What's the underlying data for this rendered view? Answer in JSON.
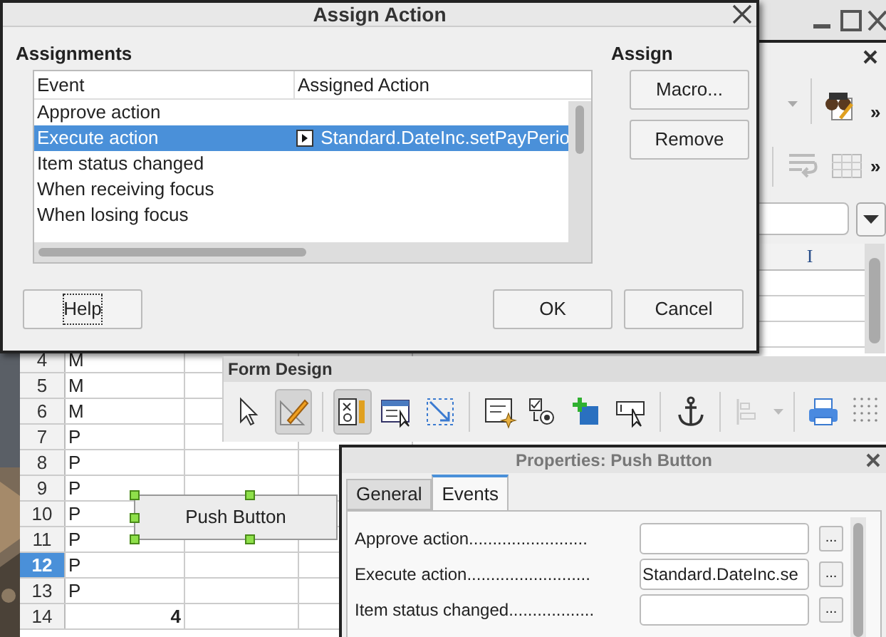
{
  "dialog": {
    "title": "Assign Action",
    "assignments_label": "Assignments",
    "assign_label": "Assign",
    "columns": [
      "Event",
      "Assigned Action"
    ],
    "events": [
      {
        "event": "Approve action",
        "selected": false
      },
      {
        "event": "Execute action",
        "action": "Standard.DateInc.setPayPerio",
        "selected": true
      },
      {
        "event": "Item status changed",
        "selected": false
      },
      {
        "event": "When receiving focus",
        "selected": false
      },
      {
        "event": "When losing focus",
        "selected": false
      }
    ],
    "assign_buttons": [
      "Macro...",
      "Remove"
    ],
    "help_button": "Help",
    "ok_button": "OK",
    "cancel_button": "Cancel"
  },
  "app_window": {
    "overflow_marks": [
      "»",
      "»"
    ],
    "column_header": "I"
  },
  "spreadsheet": {
    "rows": [
      {
        "number": "4",
        "value": "M",
        "kind": "text",
        "selected": false
      },
      {
        "number": "5",
        "value": "M",
        "kind": "text",
        "selected": false
      },
      {
        "number": "6",
        "value": "M",
        "kind": "text",
        "selected": false
      },
      {
        "number": "7",
        "value": "P",
        "kind": "text",
        "selected": false
      },
      {
        "number": "8",
        "value": "P",
        "kind": "text",
        "selected": false
      },
      {
        "number": "9",
        "value": "P",
        "kind": "text",
        "selected": false
      },
      {
        "number": "10",
        "value": "P",
        "kind": "text",
        "selected": false
      },
      {
        "number": "11",
        "value": "P",
        "kind": "text",
        "selected": false
      },
      {
        "number": "12",
        "value": "P",
        "kind": "text",
        "selected": true
      },
      {
        "number": "13",
        "value": "P",
        "kind": "text",
        "selected": false
      },
      {
        "number": "14",
        "value": "4",
        "kind": "number",
        "selected": false
      }
    ]
  },
  "form_design": {
    "title": "Form Design",
    "tools": [
      {
        "kind": "pointer",
        "pressed": false
      },
      {
        "kind": "design",
        "pressed": true
      },
      {
        "kind": "sep"
      },
      {
        "kind": "control",
        "pressed": true
      },
      {
        "kind": "form",
        "pressed": false
      },
      {
        "kind": "frame",
        "pressed": false
      },
      {
        "kind": "sep"
      },
      {
        "kind": "field",
        "pressed": false
      },
      {
        "kind": "order",
        "pressed": false
      },
      {
        "kind": "plus",
        "pressed": false
      },
      {
        "kind": "focus",
        "pressed": false
      },
      {
        "kind": "sep"
      },
      {
        "kind": "anchor",
        "pressed": false
      },
      {
        "kind": "sep"
      },
      {
        "kind": "align",
        "pressed": false
      },
      {
        "kind": "sep"
      },
      {
        "kind": "printer",
        "pressed": false
      },
      {
        "kind": "grid",
        "pressed": false
      }
    ]
  },
  "push_button": {
    "label": "Push Button",
    "selected": true
  },
  "properties": {
    "title": "Properties: Push Button",
    "tabs": [
      {
        "label": "General",
        "selected": false
      },
      {
        "label": "Events",
        "selected": true
      }
    ],
    "events": [
      {
        "label": "Approve action.........................",
        "button": "..."
      },
      {
        "label": "Execute action..........................",
        "value": "Standard.DateInc.se",
        "button": "..."
      },
      {
        "label": "Item status changed..................",
        "button": "..."
      }
    ]
  }
}
